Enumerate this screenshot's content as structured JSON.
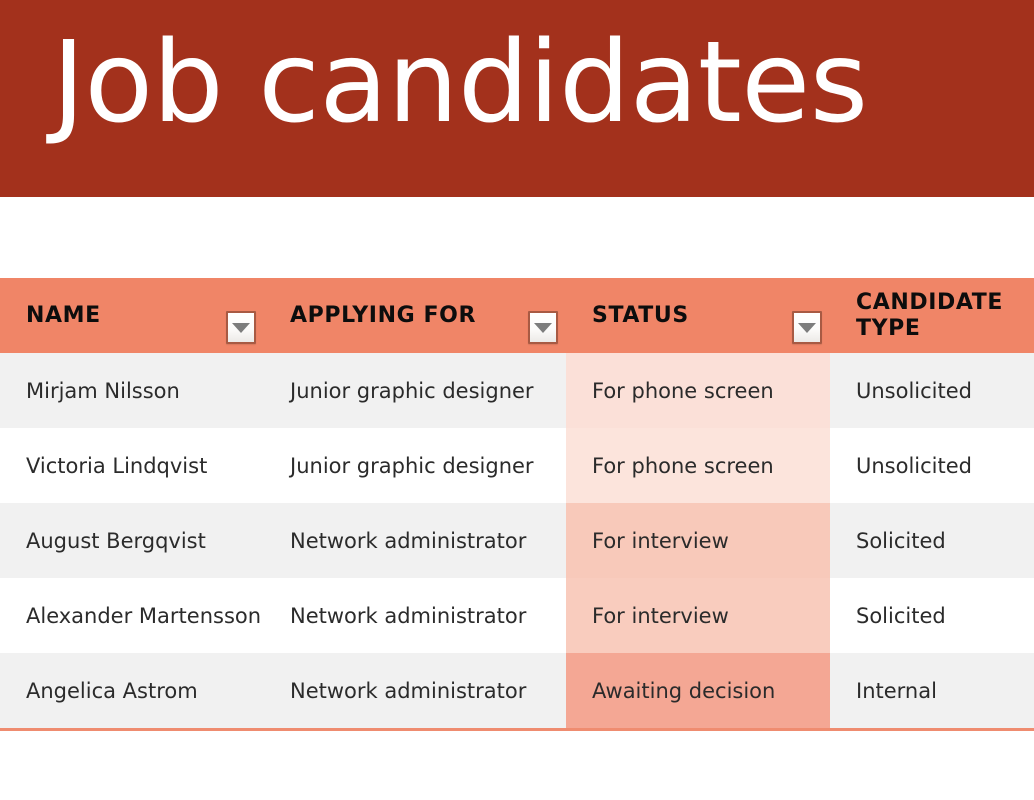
{
  "slide": {
    "title": "Job candidates",
    "colors": {
      "banner_bg": "#a3311c",
      "title_text": "#ffffff",
      "header_bg": "#f08567",
      "row_odd_bg": "#f1f1f1",
      "row_even_bg": "#ffffff",
      "bottom_rule": "#ef8c70",
      "status_scale_light": "#fbe0d8",
      "status_scale_mid": "#f8cbbd",
      "status_scale_dark": "#f4a896"
    }
  },
  "table": {
    "columns": [
      {
        "key": "name",
        "label": "NAME",
        "has_filter": true,
        "wrap": false
      },
      {
        "key": "apply",
        "label": "APPLYING FOR",
        "has_filter": true,
        "wrap": false
      },
      {
        "key": "status",
        "label": "STATUS",
        "has_filter": true,
        "wrap": false
      },
      {
        "key": "type",
        "label": "CANDIDATE TYPE",
        "has_filter": false,
        "wrap": true
      }
    ],
    "filter_icon": "chevron-down-icon",
    "rows": [
      {
        "name": "Mirjam Nilsson",
        "apply": "Junior graphic designer",
        "status": "For phone screen",
        "type": "Unsolicited",
        "status_color": "#fbe0d8"
      },
      {
        "name": "Victoria Lindqvist",
        "apply": "Junior graphic designer",
        "status": "For phone screen",
        "type": "Unsolicited",
        "status_color": "#fce4dc"
      },
      {
        "name": "August Bergqvist",
        "apply": "Network administrator",
        "status": "For interview",
        "type": "Solicited",
        "status_color": "#f8c9ba"
      },
      {
        "name": "Alexander Martensson",
        "apply": "Network administrator",
        "status": "For interview",
        "type": "Solicited",
        "status_color": "#f9ccbe"
      },
      {
        "name": "Angelica Astrom",
        "apply": "Network administrator",
        "status": "Awaiting decision",
        "type": "Internal",
        "status_color": "#f4a794"
      }
    ]
  }
}
